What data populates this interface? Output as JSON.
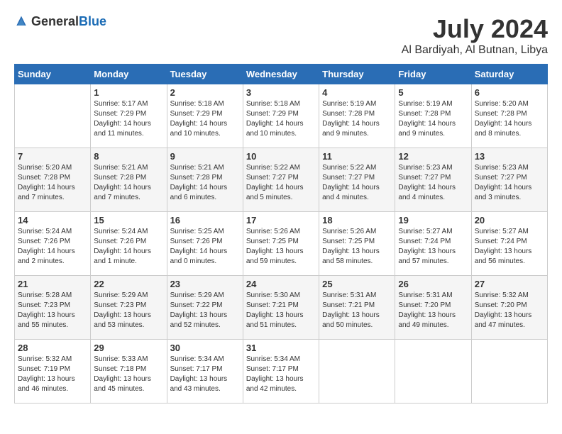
{
  "header": {
    "logo_general": "General",
    "logo_blue": "Blue",
    "month_title": "July 2024",
    "location": "Al Bardiyah, Al Butnan, Libya"
  },
  "calendar": {
    "weekdays": [
      "Sunday",
      "Monday",
      "Tuesday",
      "Wednesday",
      "Thursday",
      "Friday",
      "Saturday"
    ],
    "weeks": [
      [
        {
          "day": "",
          "sunrise": "",
          "sunset": "",
          "daylight": ""
        },
        {
          "day": "1",
          "sunrise": "Sunrise: 5:17 AM",
          "sunset": "Sunset: 7:29 PM",
          "daylight": "Daylight: 14 hours and 11 minutes."
        },
        {
          "day": "2",
          "sunrise": "Sunrise: 5:18 AM",
          "sunset": "Sunset: 7:29 PM",
          "daylight": "Daylight: 14 hours and 10 minutes."
        },
        {
          "day": "3",
          "sunrise": "Sunrise: 5:18 AM",
          "sunset": "Sunset: 7:29 PM",
          "daylight": "Daylight: 14 hours and 10 minutes."
        },
        {
          "day": "4",
          "sunrise": "Sunrise: 5:19 AM",
          "sunset": "Sunset: 7:28 PM",
          "daylight": "Daylight: 14 hours and 9 minutes."
        },
        {
          "day": "5",
          "sunrise": "Sunrise: 5:19 AM",
          "sunset": "Sunset: 7:28 PM",
          "daylight": "Daylight: 14 hours and 9 minutes."
        },
        {
          "day": "6",
          "sunrise": "Sunrise: 5:20 AM",
          "sunset": "Sunset: 7:28 PM",
          "daylight": "Daylight: 14 hours and 8 minutes."
        }
      ],
      [
        {
          "day": "7",
          "sunrise": "Sunrise: 5:20 AM",
          "sunset": "Sunset: 7:28 PM",
          "daylight": "Daylight: 14 hours and 7 minutes."
        },
        {
          "day": "8",
          "sunrise": "Sunrise: 5:21 AM",
          "sunset": "Sunset: 7:28 PM",
          "daylight": "Daylight: 14 hours and 7 minutes."
        },
        {
          "day": "9",
          "sunrise": "Sunrise: 5:21 AM",
          "sunset": "Sunset: 7:28 PM",
          "daylight": "Daylight: 14 hours and 6 minutes."
        },
        {
          "day": "10",
          "sunrise": "Sunrise: 5:22 AM",
          "sunset": "Sunset: 7:27 PM",
          "daylight": "Daylight: 14 hours and 5 minutes."
        },
        {
          "day": "11",
          "sunrise": "Sunrise: 5:22 AM",
          "sunset": "Sunset: 7:27 PM",
          "daylight": "Daylight: 14 hours and 4 minutes."
        },
        {
          "day": "12",
          "sunrise": "Sunrise: 5:23 AM",
          "sunset": "Sunset: 7:27 PM",
          "daylight": "Daylight: 14 hours and 4 minutes."
        },
        {
          "day": "13",
          "sunrise": "Sunrise: 5:23 AM",
          "sunset": "Sunset: 7:27 PM",
          "daylight": "Daylight: 14 hours and 3 minutes."
        }
      ],
      [
        {
          "day": "14",
          "sunrise": "Sunrise: 5:24 AM",
          "sunset": "Sunset: 7:26 PM",
          "daylight": "Daylight: 14 hours and 2 minutes."
        },
        {
          "day": "15",
          "sunrise": "Sunrise: 5:24 AM",
          "sunset": "Sunset: 7:26 PM",
          "daylight": "Daylight: 14 hours and 1 minute."
        },
        {
          "day": "16",
          "sunrise": "Sunrise: 5:25 AM",
          "sunset": "Sunset: 7:26 PM",
          "daylight": "Daylight: 14 hours and 0 minutes."
        },
        {
          "day": "17",
          "sunrise": "Sunrise: 5:26 AM",
          "sunset": "Sunset: 7:25 PM",
          "daylight": "Daylight: 13 hours and 59 minutes."
        },
        {
          "day": "18",
          "sunrise": "Sunrise: 5:26 AM",
          "sunset": "Sunset: 7:25 PM",
          "daylight": "Daylight: 13 hours and 58 minutes."
        },
        {
          "day": "19",
          "sunrise": "Sunrise: 5:27 AM",
          "sunset": "Sunset: 7:24 PM",
          "daylight": "Daylight: 13 hours and 57 minutes."
        },
        {
          "day": "20",
          "sunrise": "Sunrise: 5:27 AM",
          "sunset": "Sunset: 7:24 PM",
          "daylight": "Daylight: 13 hours and 56 minutes."
        }
      ],
      [
        {
          "day": "21",
          "sunrise": "Sunrise: 5:28 AM",
          "sunset": "Sunset: 7:23 PM",
          "daylight": "Daylight: 13 hours and 55 minutes."
        },
        {
          "day": "22",
          "sunrise": "Sunrise: 5:29 AM",
          "sunset": "Sunset: 7:23 PM",
          "daylight": "Daylight: 13 hours and 53 minutes."
        },
        {
          "day": "23",
          "sunrise": "Sunrise: 5:29 AM",
          "sunset": "Sunset: 7:22 PM",
          "daylight": "Daylight: 13 hours and 52 minutes."
        },
        {
          "day": "24",
          "sunrise": "Sunrise: 5:30 AM",
          "sunset": "Sunset: 7:21 PM",
          "daylight": "Daylight: 13 hours and 51 minutes."
        },
        {
          "day": "25",
          "sunrise": "Sunrise: 5:31 AM",
          "sunset": "Sunset: 7:21 PM",
          "daylight": "Daylight: 13 hours and 50 minutes."
        },
        {
          "day": "26",
          "sunrise": "Sunrise: 5:31 AM",
          "sunset": "Sunset: 7:20 PM",
          "daylight": "Daylight: 13 hours and 49 minutes."
        },
        {
          "day": "27",
          "sunrise": "Sunrise: 5:32 AM",
          "sunset": "Sunset: 7:20 PM",
          "daylight": "Daylight: 13 hours and 47 minutes."
        }
      ],
      [
        {
          "day": "28",
          "sunrise": "Sunrise: 5:32 AM",
          "sunset": "Sunset: 7:19 PM",
          "daylight": "Daylight: 13 hours and 46 minutes."
        },
        {
          "day": "29",
          "sunrise": "Sunrise: 5:33 AM",
          "sunset": "Sunset: 7:18 PM",
          "daylight": "Daylight: 13 hours and 45 minutes."
        },
        {
          "day": "30",
          "sunrise": "Sunrise: 5:34 AM",
          "sunset": "Sunset: 7:17 PM",
          "daylight": "Daylight: 13 hours and 43 minutes."
        },
        {
          "day": "31",
          "sunrise": "Sunrise: 5:34 AM",
          "sunset": "Sunset: 7:17 PM",
          "daylight": "Daylight: 13 hours and 42 minutes."
        },
        {
          "day": "",
          "sunrise": "",
          "sunset": "",
          "daylight": ""
        },
        {
          "day": "",
          "sunrise": "",
          "sunset": "",
          "daylight": ""
        },
        {
          "day": "",
          "sunrise": "",
          "sunset": "",
          "daylight": ""
        }
      ]
    ]
  }
}
